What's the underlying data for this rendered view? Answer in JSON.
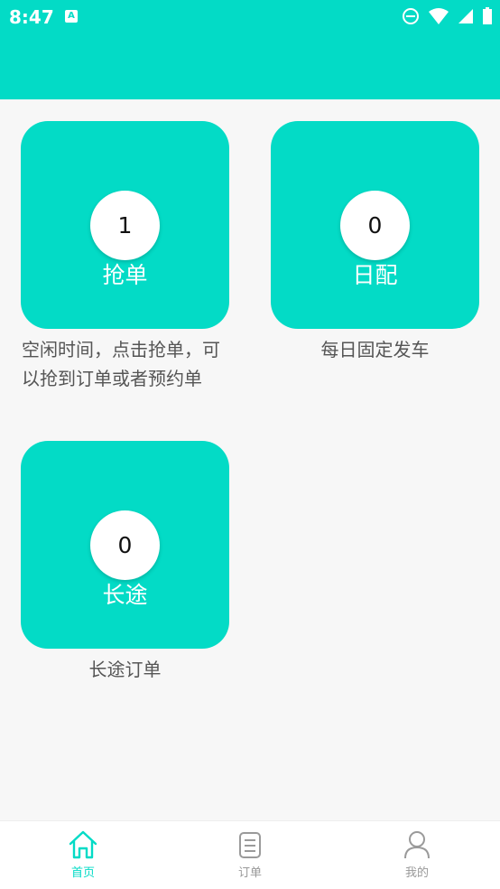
{
  "status_bar": {
    "time": "8:47",
    "app_icon_letter": "A"
  },
  "cards": [
    {
      "title": "抢单",
      "count": "1",
      "description": "空闲时间，点击抢单，可以抢到订单或者预约单"
    },
    {
      "title": "日配",
      "count": "0",
      "description": "每日固定发车"
    },
    {
      "title": "长途",
      "count": "0",
      "description": "长途订单"
    }
  ],
  "bottom_nav": {
    "items": [
      {
        "label": "首页",
        "icon": "home-icon",
        "active": true
      },
      {
        "label": "订单",
        "icon": "order-list-icon",
        "active": false
      },
      {
        "label": "我的",
        "icon": "profile-icon",
        "active": false
      }
    ]
  },
  "colors": {
    "accent": "#03dbc6",
    "background": "#f7f7f7",
    "inactive": "#999999"
  }
}
